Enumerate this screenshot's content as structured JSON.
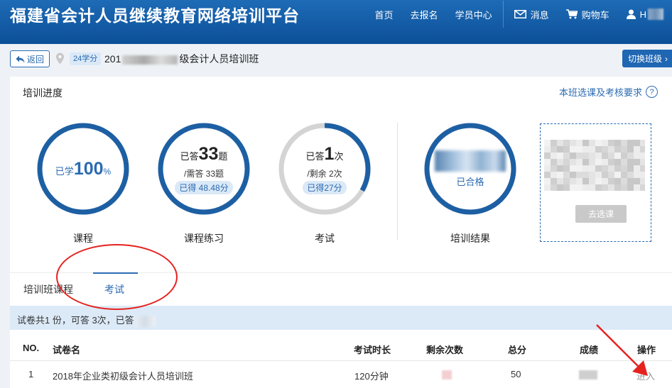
{
  "header": {
    "brand": "福建省会计人员继续教育网络培训平台",
    "nav": {
      "home": "首页",
      "register": "去报名",
      "student_center": "学员中心",
      "messages": "消息",
      "cart": "购物车",
      "user": "H"
    },
    "colors": {
      "header_bg": "#1567b2",
      "accent": "#2b6bb1"
    }
  },
  "subbar": {
    "back": "返回",
    "credits": "24学分",
    "class_prefix": "201",
    "class_suffix": "级会计人员培训班",
    "switch_class": "切换班级"
  },
  "progress": {
    "title": "培训进度",
    "rules_link": "本班选课及考核要求",
    "help_icon": "question-icon",
    "course": {
      "prefix": "已学",
      "value": "100",
      "unit": "%",
      "caption": "课程",
      "fraction": 1.0
    },
    "practice": {
      "prefix": "已答",
      "value": "33",
      "unit": "题",
      "required": "/需答 33题",
      "score": "已得 48.48分",
      "caption": "课程练习",
      "fraction": 1.0
    },
    "exam": {
      "prefix": "已答",
      "value": "1",
      "unit": "次",
      "remaining": "/剩余 2次",
      "score": "已得27分",
      "caption": "考试",
      "fraction": 0.3333
    },
    "result": {
      "status": "已合格",
      "caption": "培训结果",
      "fraction": 1.0
    },
    "select_course_button": "去选课"
  },
  "tabs": [
    {
      "label": "培训班课程",
      "active": false
    },
    {
      "label": "考试",
      "active": true
    }
  ],
  "exam_info": {
    "summary": "试卷共1 份，可答 3次，已答"
  },
  "table": {
    "headers": [
      "NO.",
      "试卷名",
      "考试时长",
      "剩余次数",
      "总分",
      "成绩",
      "操作"
    ],
    "rows": [
      {
        "no": "1",
        "name": "2018年企业类初级会计人员培训班",
        "duration": "120分钟",
        "remaining": "",
        "total": "50",
        "score": "",
        "action": "进入"
      }
    ]
  }
}
